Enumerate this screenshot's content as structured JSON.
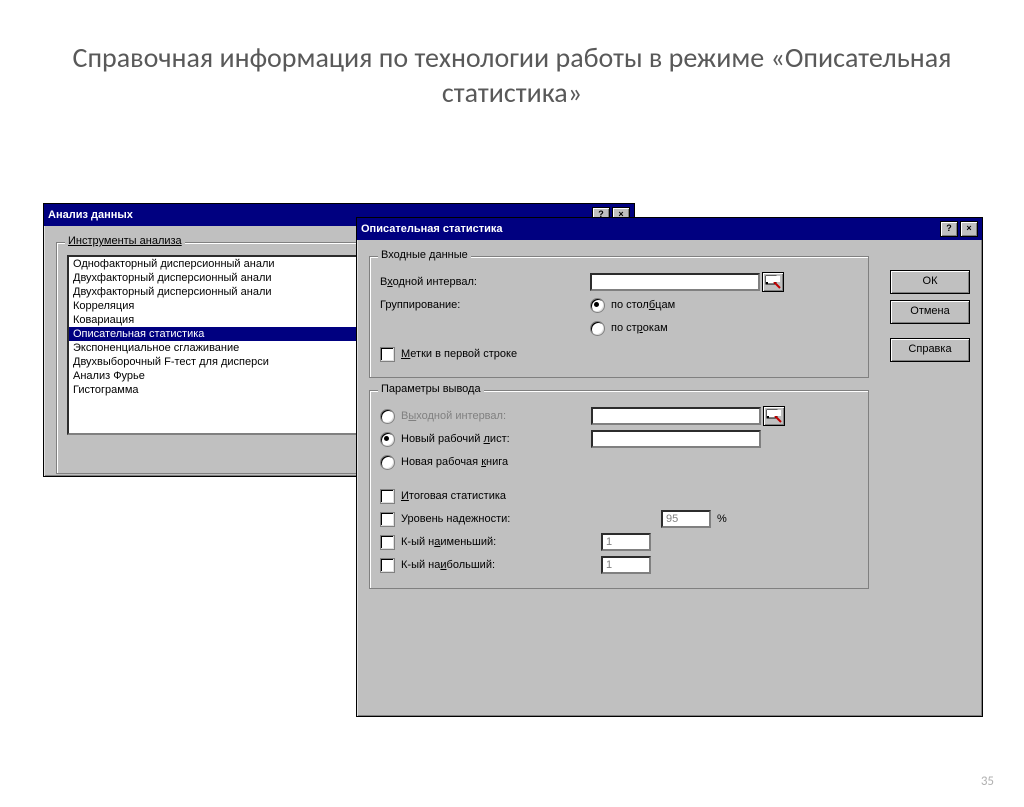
{
  "slide": {
    "title": "Справочная информация по технологии работы в режиме «Описательная статистика»",
    "page_number": "35"
  },
  "dialog1": {
    "title": "Анализ данных",
    "list_label": "Инструменты анализа",
    "items": [
      "Однофакторный дисперсионный анали",
      "Двухфакторный дисперсионный анали",
      "Двухфакторный дисперсионный анали",
      "Корреляция",
      "Ковариация",
      "Описательная статистика",
      "Экспоненциальное сглаживание",
      "Двухвыборочный F-тест для дисперси",
      "Анализ Фурье",
      "Гистограмма"
    ],
    "selected_index": 5
  },
  "dialog2": {
    "title": "Описательная статистика",
    "input_group": "Входные данные",
    "input_range_label": "Входной интервал:",
    "input_range_value": "",
    "grouping_label": "Группирование:",
    "grouping_columns": "по столбцам",
    "grouping_rows": "по строкам",
    "labels_first_row": "Метки в первой строке",
    "output_group": "Параметры вывода",
    "output_range_label": "Выходной интервал:",
    "new_sheet_label": "Новый рабочий лист:",
    "new_sheet_value": "",
    "new_book_label": "Новая рабочая книга",
    "summary_stats": "Итоговая статистика",
    "confidence_label": "Уровень надежности:",
    "confidence_value": "95",
    "confidence_unit": "%",
    "kth_smallest": "К-ый наименьший:",
    "kth_smallest_value": "1",
    "kth_largest": "К-ый наибольший:",
    "kth_largest_value": "1",
    "buttons": {
      "ok": "ОК",
      "cancel": "Отмена",
      "help": "Справка"
    }
  }
}
